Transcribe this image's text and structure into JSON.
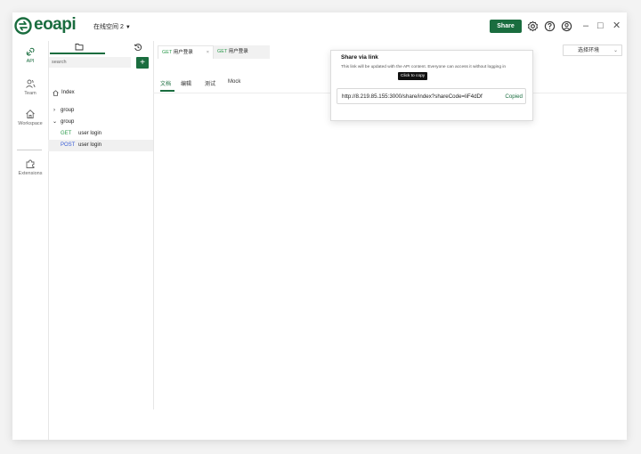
{
  "app": {
    "name": "eoapi",
    "workspace": "在线空间 2"
  },
  "header": {
    "share_label": "Share",
    "icons": [
      "gear-icon",
      "help-icon",
      "user-icon"
    ]
  },
  "window_controls": {
    "minimize": "–",
    "maximize": "□",
    "close": "✕"
  },
  "nav": {
    "items": [
      {
        "label": "API",
        "icon": "api-icon"
      },
      {
        "label": "Team",
        "icon": "team-icon"
      },
      {
        "label": "Workspace",
        "icon": "home-icon"
      },
      {
        "label": "Extensions",
        "icon": "puzzle-icon"
      }
    ]
  },
  "sidebar": {
    "search_placeholder": "search",
    "add_label": "+",
    "index_label": "Index",
    "groups": [
      {
        "label": "group",
        "expanded": false
      },
      {
        "label": "group",
        "expanded": true
      }
    ],
    "items": [
      {
        "method": "GET",
        "name": "user login"
      },
      {
        "method": "POST",
        "name": "user login"
      }
    ]
  },
  "tabs": [
    {
      "method": "GET",
      "title": "用户登录",
      "close": "×"
    },
    {
      "method": "GET",
      "title": "用户登录"
    }
  ],
  "env_select": {
    "label": "选择环境"
  },
  "subtabs": [
    "文档",
    "编辑",
    "测试",
    "Mock"
  ],
  "share_popover": {
    "title": "Share via link",
    "description": "This link will be updated with the API content. Everyone can access it without logging in",
    "tooltip": "Click to copy",
    "link": "http://8.219.85.155:3000/share/index?shareCode=liF4dDf",
    "copied_label": "Copied"
  },
  "colors": {
    "brand": "#1a6d3f",
    "get": "#2e9b4e",
    "post": "#3a5ed6"
  }
}
